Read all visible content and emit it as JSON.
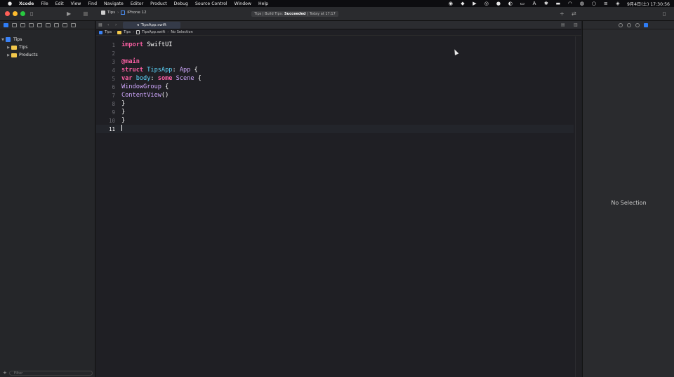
{
  "menubar": {
    "items": [
      "Xcode",
      "File",
      "Edit",
      "View",
      "Find",
      "Navigate",
      "Editor",
      "Product",
      "Debug",
      "Source Control",
      "Window",
      "Help"
    ],
    "clock": "9月4日(土) 17:30:56"
  },
  "toolbar": {
    "scheme": "Tips",
    "device": "iPhone 12",
    "activity_prefix": "Tips | Build Tips:",
    "activity_status": "Succeeded",
    "activity_suffix": "| Today at 17:17"
  },
  "navigator": {
    "project": "Tips",
    "items": [
      "Tips",
      "Products"
    ],
    "filter_placeholder": "Filter"
  },
  "editor": {
    "tab_label": "TipsApp.swift",
    "jumpbar": [
      "Tips",
      "Tips",
      "TipsApp.swift",
      "No Selection"
    ],
    "line_numbers": [
      "1",
      "2",
      "3",
      "4",
      "5",
      "6",
      "7",
      "8",
      "9",
      "10",
      "11"
    ],
    "code": {
      "l1_kw": "import",
      "l1_rest": " SwiftUI",
      "l3_attr": "@main",
      "l4_kw": "struct",
      "l4_name": " TipsApp",
      "l4_colon": ": ",
      "l4_type": "App",
      "l4_brace": " {",
      "l5_kw": "var",
      "l5_name": " body",
      "l5_colon": ": ",
      "l5_kw2": "some",
      "l5_type": " Scene",
      "l5_brace": " {",
      "l6_type": "WindowGroup",
      "l6_brace": " {",
      "l7_type": "ContentView",
      "l7_parens": "()",
      "close_brace": "}"
    },
    "current_line": "11"
  },
  "inspector": {
    "empty_label": "No Selection"
  },
  "colors": {
    "keyword": "#fc5fa3",
    "type": "#5dd8ff",
    "attribute": "#fd8f3f",
    "accent": "#2f7df6"
  }
}
